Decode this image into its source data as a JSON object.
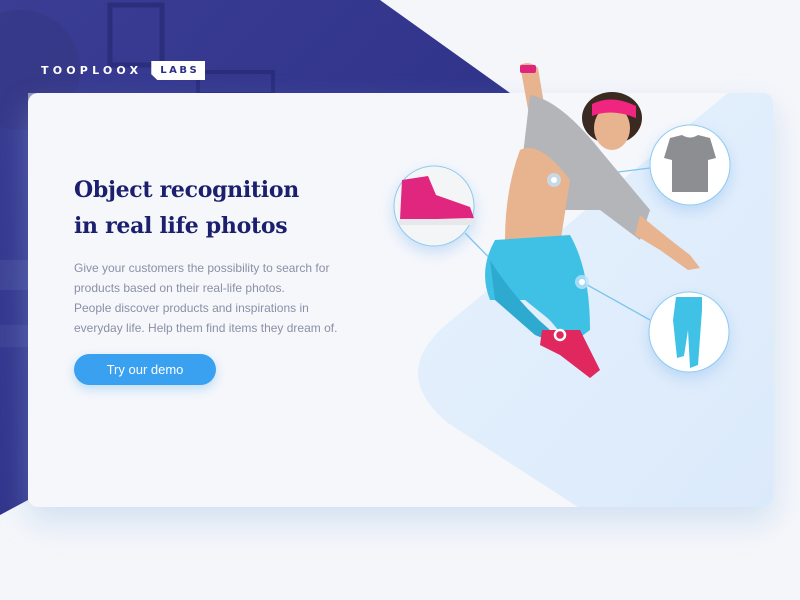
{
  "brand": {
    "name": "TOOPLOOX",
    "badge": "LABS"
  },
  "hero": {
    "title_line1": "Object recognition",
    "title_line2": "in real life photos",
    "description": [
      "Give your customers the possibility to search for",
      "products based on their real-life photos.",
      "People discover products and inspirations in",
      "everyday life. Help them find items they dream of."
    ],
    "cta_label": "Try our demo"
  },
  "detected_items": [
    {
      "name": "sneaker",
      "color": "#e0257f"
    },
    {
      "name": "t-shirt",
      "color": "#8c8e92"
    },
    {
      "name": "trousers",
      "color": "#3fc1e6"
    }
  ],
  "colors": {
    "primary_navy": "#2b2f86",
    "heading": "#1b1f6e",
    "accent_blue": "#3aa0f0",
    "connector": "#7cc4ee"
  }
}
